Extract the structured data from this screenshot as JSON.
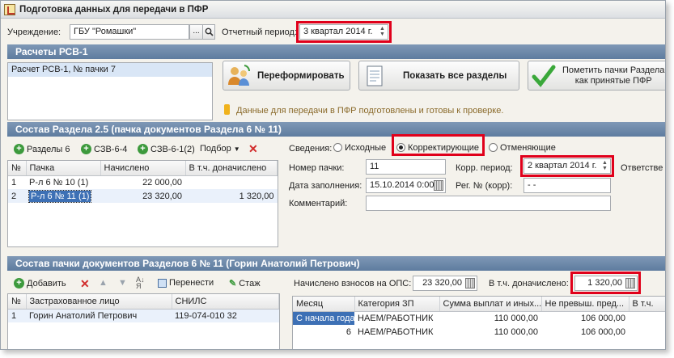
{
  "window": {
    "title": "Подготовка данных для передачи в ПФР"
  },
  "header": {
    "institution_label": "Учреждение:",
    "institution_value": "ГБУ \"Ромашки\"",
    "institution_select": "...",
    "period_label": "Отчетный период:",
    "period_value": "3 квартал 2014 г."
  },
  "rsv": {
    "section_title": "Расчеты РСВ-1",
    "list": [
      "Расчет РСВ-1, № пачки 7"
    ],
    "reform_button": "Переформировать",
    "show_all_button": "Показать все разделы",
    "mark_button_line1": "Пометить пачки Раздела",
    "mark_button_line2": "как принятые ПФР",
    "info_text": "Данные для передачи в ПФР подготовлены и готовы к проверке."
  },
  "section25": {
    "title": "Состав Раздела 2.5    (пачка документов Раздела 6 № 11)",
    "toolbar": [
      "Разделы 6",
      "СЗВ-6-4",
      "СЗВ-6-1(2)",
      "Подбор"
    ],
    "columns": [
      "№",
      "Пачка",
      "Начислено",
      "В т.ч. доначислено"
    ],
    "rows": [
      {
        "n": "1",
        "pack": "Р-л 6 № 10 (1)",
        "accrued": "22 000,00",
        "extra": ""
      },
      {
        "n": "2",
        "pack": "Р-л 6 № 11 (1)",
        "accrued": "23 320,00",
        "extra": "1 320,00"
      }
    ],
    "info_label": "Сведения:",
    "radio_options": [
      "Исходные",
      "Корректирующие",
      "Отменяющие"
    ],
    "radio_selected": "Корректирующие",
    "pack_no_label": "Номер пачки:",
    "pack_no_value": "11",
    "corr_period_label": "Корр. период:",
    "corr_period_value": "2 квартал 2014 г.",
    "responsible_label": "Ответстве",
    "fill_date_label": "Дата заполнения:",
    "fill_date_value": "15.10.2014  0:00",
    "reg_no_label": "Рег. № (корр):",
    "reg_no_value": "-   -",
    "comment_label": "Комментарий:",
    "comment_value": ""
  },
  "section6": {
    "title": "Состав пачки документов Разделов 6 № 11        (Горин Анатолий Петрович)",
    "toolbar": [
      "Добавить",
      "Перенести",
      "Стаж"
    ],
    "columns": [
      "№",
      "Застрахованное лицо",
      "СНИЛС"
    ],
    "rows": [
      {
        "n": "1",
        "person": "Горин Анатолий Петрович",
        "snils": "119-074-010 32"
      }
    ],
    "accrued_label": "Начислено взносов на ОПС:",
    "accrued_value": "23 320,00",
    "extra_label": "В т.ч. доначислено:",
    "extra_value": "1 320,00",
    "pay_columns": [
      "Месяц",
      "Категория ЗП",
      "Сумма выплат и иных...",
      "Не превыш. пред...",
      "В т.ч."
    ],
    "pay_rows": [
      {
        "month": "С начала года",
        "category": "НАЕМ/РАБОТНИК",
        "sum": "110 000,00",
        "limit": "106 000,00"
      },
      {
        "month": "6",
        "category": "НАЕМ/РАБОТНИК",
        "sum": "110 000,00",
        "limit": "106 000,00"
      }
    ]
  },
  "colors": {
    "section_bar": "#6f8bad",
    "highlight": "#e0001b",
    "selection": "#3d70b5"
  }
}
